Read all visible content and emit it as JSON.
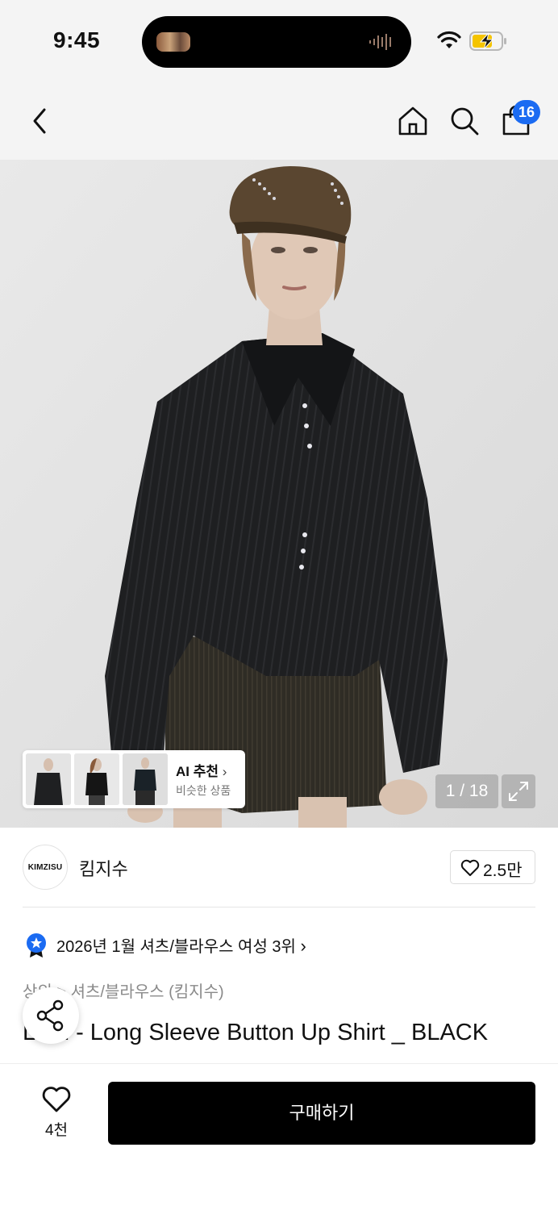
{
  "status_bar": {
    "time": "9:45",
    "battery_color": "#f5c400"
  },
  "header": {
    "back_icon": "chevron-left-icon",
    "home_icon": "home-icon",
    "search_icon": "search-icon",
    "bag_icon": "shopping-bag-icon",
    "cart_count": "16",
    "badge_color": "#1b6bf2"
  },
  "gallery": {
    "current": "1 / 18",
    "ai_title": "AI 추천",
    "ai_subtitle": "비슷한 상품"
  },
  "brand": {
    "logo_text": "KIMZISU",
    "name": "킴지수",
    "likes": "2.5만"
  },
  "ranking": {
    "text": "2026년 1월 셔츠/블라우스 여성 3위"
  },
  "product": {
    "category": "상의 > 셔츠/블라우스 (킴지수)",
    "title": "Lizzi - Long Sleeve Button Up Shirt _ BLACK"
  },
  "bottom": {
    "wish_count": "4천",
    "buy_label": "구매하기"
  }
}
